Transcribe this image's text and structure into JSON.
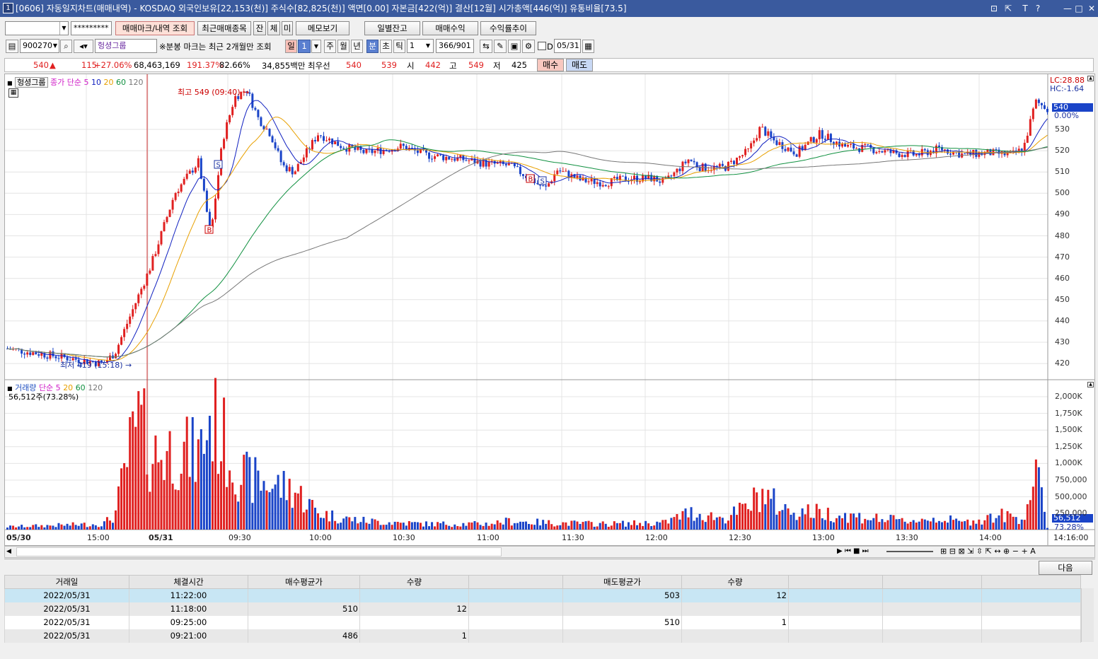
{
  "window": {
    "app_icon": "1",
    "title": "[0606] 자동일지차트(매매내역) - KOSDAQ 외국인보유[22,153(천)] 주식수[82,825(천)] 액면[0.00] 자본금[422(억)] 결산[12월] 시가총액[446(억)] 유통비율[73.5]",
    "controls": [
      "⊡",
      "⇱",
      "T",
      "?",
      "—",
      "□",
      "✕"
    ]
  },
  "toolbar1": {
    "account": "",
    "password": "*********",
    "buttons": [
      "매매마크/내역 조회",
      "최근매매종목",
      "잔",
      "체",
      "미",
      "메모보기",
      "일별잔고",
      "매매수익",
      "수익률추이"
    ]
  },
  "toolbar2": {
    "code": "900270",
    "name": "헝셩그룹",
    "notice": "※분봉 마크는 최근 2개월만 조회",
    "periods": [
      "일",
      "1",
      "주",
      "월",
      "년",
      "분",
      "초",
      "틱"
    ],
    "tick_value": "1",
    "count": "366/901",
    "date_check": "D",
    "date": "05/31"
  },
  "quote": {
    "price": "540",
    "arrow": "▲",
    "change": "115",
    "change_pct": "+27.06%",
    "volume": "68,463,169",
    "vol_ratio": "191.37%",
    "turnover": "82.66%",
    "amount": "34,855백만",
    "bid_label": "최우선",
    "ask": "540",
    "bid": "539",
    "open_label": "시",
    "open": "442",
    "high_label": "고",
    "high": "549",
    "low_label": "저",
    "low": "425",
    "buy": "매수",
    "sell": "매도"
  },
  "colors": {
    "up": "#e02020",
    "down": "#1a44c8",
    "ma5": "#d020c8",
    "ma10": "#1020c0",
    "ma20": "#e8a000",
    "ma60": "#109040",
    "ma120": "#777777"
  },
  "price_panel": {
    "stock_label": "헝셩그룹",
    "legend": [
      {
        "text": "종가 단순 5",
        "color": "#d020c8"
      },
      {
        "text": "10",
        "color": "#1020c0"
      },
      {
        "text": "20",
        "color": "#e8a000"
      },
      {
        "text": "60",
        "color": "#109040"
      },
      {
        "text": "120",
        "color": "#777777"
      }
    ],
    "high_note": "최고 549 (09:40)",
    "low_note": "최저 419 (15:18)",
    "lc": "LC:28.88",
    "hc": "HC:-1.64",
    "cur_price": "540",
    "cur_pct": "0.00%",
    "y_ticks": [
      "530",
      "520",
      "510",
      "500",
      "490",
      "480",
      "470",
      "460",
      "450",
      "440",
      "430",
      "420"
    ]
  },
  "volume_panel": {
    "legend": [
      {
        "text": "거래량",
        "color": "#2050c0"
      },
      {
        "text": "단순 5",
        "color": "#d020c8"
      },
      {
        "text": "20",
        "color": "#e8a000"
      },
      {
        "text": "60",
        "color": "#109040"
      },
      {
        "text": "120",
        "color": "#777777"
      }
    ],
    "info": "56,512주(73.28%)",
    "cur": "56,512",
    "cur_pct": "73.28%",
    "y_ticks": [
      "2,000K",
      "1,750K",
      "1,500K",
      "1,250K",
      "1,000K",
      "750,000",
      "500,000",
      "250,000"
    ]
  },
  "x_axis": [
    "05/30",
    "15:00",
    "05/31",
    "09:30",
    "10:00",
    "10:30",
    "11:00",
    "11:30",
    "12:00",
    "12:30",
    "13:00",
    "13:30",
    "14:00",
    "14:16:00"
  ],
  "chart_data": {
    "type": "candlestick",
    "series": [
      {
        "name": "헝셩그룹",
        "points": [
          [
            0,
            427
          ],
          [
            8,
            420
          ],
          [
            9,
            425
          ],
          [
            12,
            466
          ],
          [
            14,
            500
          ],
          [
            16,
            515
          ],
          [
            17,
            480
          ],
          [
            18,
            525
          ],
          [
            19,
            545
          ],
          [
            20,
            549
          ],
          [
            21,
            535
          ],
          [
            22,
            528
          ],
          [
            23,
            513
          ],
          [
            24,
            510
          ],
          [
            26,
            528
          ],
          [
            28,
            522
          ],
          [
            30,
            519
          ],
          [
            33,
            522
          ],
          [
            35,
            518
          ],
          [
            38,
            516
          ],
          [
            40,
            514
          ],
          [
            42,
            513
          ],
          [
            44,
            506
          ],
          [
            45,
            502
          ],
          [
            46,
            511
          ],
          [
            48,
            506
          ],
          [
            50,
            505
          ],
          [
            52,
            507
          ],
          [
            54,
            507
          ],
          [
            55,
            505
          ],
          [
            57,
            516
          ],
          [
            58,
            512
          ],
          [
            60,
            512
          ],
          [
            62,
            520
          ],
          [
            63,
            531
          ],
          [
            64,
            525
          ],
          [
            66,
            519
          ],
          [
            68,
            528
          ],
          [
            70,
            522
          ],
          [
            72,
            521
          ],
          [
            74,
            519
          ],
          [
            76,
            518
          ],
          [
            78,
            521
          ],
          [
            80,
            518
          ],
          [
            82,
            519
          ],
          [
            84,
            518
          ],
          [
            85,
            521
          ],
          [
            86,
            543
          ],
          [
            87,
            540
          ]
        ]
      },
      {
        "name": "거래량",
        "points": [
          [
            0,
            50
          ],
          [
            8,
            100
          ],
          [
            9,
            250
          ],
          [
            10,
            1200
          ],
          [
            11,
            1900
          ],
          [
            12,
            1300
          ],
          [
            14,
            1400
          ],
          [
            16,
            1300
          ],
          [
            17,
            2000
          ],
          [
            18,
            1600
          ],
          [
            19,
            1100
          ],
          [
            20,
            900
          ],
          [
            22,
            800
          ],
          [
            24,
            700
          ],
          [
            26,
            300
          ],
          [
            28,
            200
          ],
          [
            30,
            150
          ],
          [
            35,
            100
          ],
          [
            40,
            100
          ],
          [
            42,
            150
          ],
          [
            45,
            120
          ],
          [
            50,
            100
          ],
          [
            55,
            120
          ],
          [
            57,
            300
          ],
          [
            60,
            200
          ],
          [
            62,
            400
          ],
          [
            63,
            650
          ],
          [
            65,
            350
          ],
          [
            68,
            300
          ],
          [
            70,
            250
          ],
          [
            75,
            150
          ],
          [
            78,
            200
          ],
          [
            80,
            120
          ],
          [
            83,
            250
          ],
          [
            85,
            200
          ],
          [
            86,
            1000
          ],
          [
            87,
            56
          ]
        ]
      }
    ]
  },
  "nav": {
    "zoom_icons": [
      "⊞",
      "⊟",
      "⊠",
      "⇲",
      "⇳",
      "⇱",
      "↔",
      "⊕",
      "−",
      "+",
      "A"
    ]
  },
  "table": {
    "next_button": "다음",
    "headers": [
      "거래일",
      "체결시간",
      "매수평균가",
      "수량",
      "",
      "매도평균가",
      "수량",
      "",
      "",
      ""
    ],
    "rows": [
      {
        "date": "2022/05/31",
        "time": "11:22:00",
        "buy_avg": "",
        "buy_qty": "",
        "sell_avg": "503",
        "sell_qty": "12"
      },
      {
        "date": "2022/05/31",
        "time": "11:18:00",
        "buy_avg": "510",
        "buy_qty": "12",
        "sell_avg": "",
        "sell_qty": ""
      },
      {
        "date": "2022/05/31",
        "time": "09:25:00",
        "buy_avg": "",
        "buy_qty": "",
        "sell_avg": "510",
        "sell_qty": "1"
      },
      {
        "date": "2022/05/31",
        "time": "09:21:00",
        "buy_avg": "486",
        "buy_qty": "1",
        "sell_avg": "",
        "sell_qty": ""
      }
    ]
  }
}
